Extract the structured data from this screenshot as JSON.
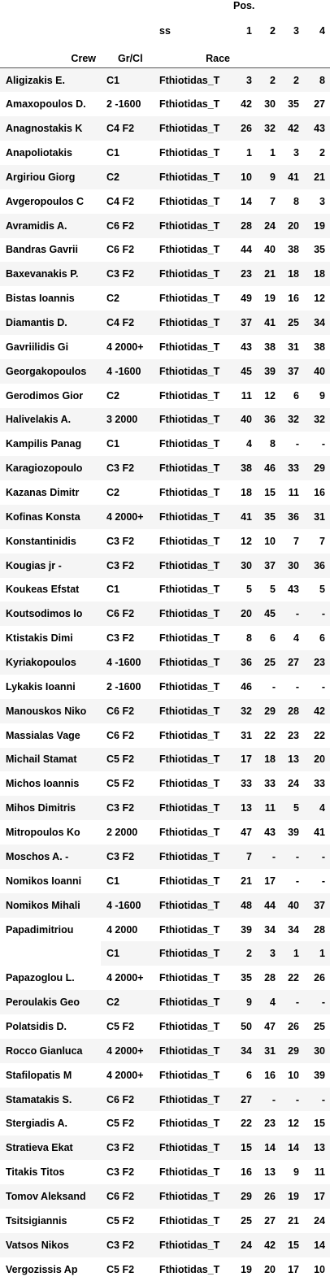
{
  "header": {
    "pos_label": "Pos.",
    "ss_label": "ss",
    "crew_label": "Crew",
    "grcl_label": "Gr/Cl",
    "race_label": "Race",
    "pos_cols": [
      "1",
      "2",
      "3",
      "4"
    ]
  },
  "rows": [
    {
      "crew": "Aligizakis E.",
      "gr": "C1",
      "race": "Fthiotidas_T",
      "p": [
        "3",
        "2",
        "2",
        "8"
      ]
    },
    {
      "crew": "Amaxopoulos D.",
      "gr": "2 -1600",
      "race": "Fthiotidas_T",
      "p": [
        "42",
        "30",
        "35",
        "27"
      ]
    },
    {
      "crew": "Anagnostakis K",
      "gr": "C4 F2",
      "race": "Fthiotidas_T",
      "p": [
        "26",
        "32",
        "42",
        "43"
      ]
    },
    {
      "crew": "Anapoliotakis",
      "gr": "C1",
      "race": "Fthiotidas_T",
      "p": [
        "1",
        "1",
        "3",
        "2"
      ]
    },
    {
      "crew": "Argiriou Giorg",
      "gr": "C2",
      "race": "Fthiotidas_T",
      "p": [
        "10",
        "9",
        "41",
        "21"
      ]
    },
    {
      "crew": "Avgeropoulos C",
      "gr": "C4 F2",
      "race": "Fthiotidas_T",
      "p": [
        "14",
        "7",
        "8",
        "3"
      ]
    },
    {
      "crew": "Avramidis A.",
      "gr": "C6 F2",
      "race": "Fthiotidas_T",
      "p": [
        "28",
        "24",
        "20",
        "19"
      ]
    },
    {
      "crew": "Bandras Gavrii",
      "gr": "C6 F2",
      "race": "Fthiotidas_T",
      "p": [
        "44",
        "40",
        "38",
        "35"
      ]
    },
    {
      "crew": "Baxevanakis P.",
      "gr": "C3 F2",
      "race": "Fthiotidas_T",
      "p": [
        "23",
        "21",
        "18",
        "18"
      ]
    },
    {
      "crew": "Bistas Ioannis",
      "gr": "C2",
      "race": "Fthiotidas_T",
      "p": [
        "49",
        "19",
        "16",
        "12"
      ]
    },
    {
      "crew": "Diamantis D.",
      "gr": "C4 F2",
      "race": "Fthiotidas_T",
      "p": [
        "37",
        "41",
        "25",
        "34"
      ]
    },
    {
      "crew": "Gavriilidis Gi",
      "gr": "4 2000+",
      "race": "Fthiotidas_T",
      "p": [
        "43",
        "38",
        "31",
        "38"
      ]
    },
    {
      "crew": "Georgakopoulos",
      "gr": "4 -1600",
      "race": "Fthiotidas_T",
      "p": [
        "45",
        "39",
        "37",
        "40"
      ]
    },
    {
      "crew": "Gerodimos Gior",
      "gr": "C2",
      "race": "Fthiotidas_T",
      "p": [
        "11",
        "12",
        "6",
        "9"
      ]
    },
    {
      "crew": "Halivelakis A.",
      "gr": "3 2000",
      "race": "Fthiotidas_T",
      "p": [
        "40",
        "36",
        "32",
        "32"
      ]
    },
    {
      "crew": "Kampilis Panag",
      "gr": "C1",
      "race": "Fthiotidas_T",
      "p": [
        "4",
        "8",
        "-",
        "-"
      ]
    },
    {
      "crew": "Karagiozopoulo",
      "gr": "C3 F2",
      "race": "Fthiotidas_T",
      "p": [
        "38",
        "46",
        "33",
        "29"
      ]
    },
    {
      "crew": "Kazanas Dimitr",
      "gr": "C2",
      "race": "Fthiotidas_T",
      "p": [
        "18",
        "15",
        "11",
        "16"
      ]
    },
    {
      "crew": "Kofinas Konsta",
      "gr": "4 2000+",
      "race": "Fthiotidas_T",
      "p": [
        "41",
        "35",
        "36",
        "31"
      ]
    },
    {
      "crew": "Konstantinidis",
      "gr": "C3 F2",
      "race": "Fthiotidas_T",
      "p": [
        "12",
        "10",
        "7",
        "7"
      ]
    },
    {
      "crew": "Kougias jr -",
      "gr": "C3 F2",
      "race": "Fthiotidas_T",
      "p": [
        "30",
        "37",
        "30",
        "36"
      ]
    },
    {
      "crew": "Koukeas Efstat",
      "gr": "C1",
      "race": "Fthiotidas_T",
      "p": [
        "5",
        "5",
        "43",
        "5"
      ]
    },
    {
      "crew": "Koutsodimos Io",
      "gr": "C6 F2",
      "race": "Fthiotidas_T",
      "p": [
        "20",
        "45",
        "-",
        "-"
      ]
    },
    {
      "crew": "Ktistakis Dimi",
      "gr": "C3 F2",
      "race": "Fthiotidas_T",
      "p": [
        "8",
        "6",
        "4",
        "6"
      ]
    },
    {
      "crew": "Kyriakopoulos",
      "gr": "4 -1600",
      "race": "Fthiotidas_T",
      "p": [
        "36",
        "25",
        "27",
        "23"
      ]
    },
    {
      "crew": "Lykakis Ioanni",
      "gr": "2 -1600",
      "race": "Fthiotidas_T",
      "p": [
        "46",
        "-",
        "-",
        "-"
      ]
    },
    {
      "crew": "Manouskos Niko",
      "gr": "C6 F2",
      "race": "Fthiotidas_T",
      "p": [
        "32",
        "29",
        "28",
        "42"
      ]
    },
    {
      "crew": "Massialas Vage",
      "gr": "C6 F2",
      "race": "Fthiotidas_T",
      "p": [
        "31",
        "22",
        "23",
        "22"
      ]
    },
    {
      "crew": "Michail Stamat",
      "gr": "C5 F2",
      "race": "Fthiotidas_T",
      "p": [
        "17",
        "18",
        "13",
        "20"
      ]
    },
    {
      "crew": "Michos Ioannis",
      "gr": "C5 F2",
      "race": "Fthiotidas_T",
      "p": [
        "33",
        "33",
        "24",
        "33"
      ]
    },
    {
      "crew": "Mihos Dimitris",
      "gr": "C3 F2",
      "race": "Fthiotidas_T",
      "p": [
        "13",
        "11",
        "5",
        "4"
      ]
    },
    {
      "crew": "Mitropoulos Ko",
      "gr": "2 2000",
      "race": "Fthiotidas_T",
      "p": [
        "47",
        "43",
        "39",
        "41"
      ]
    },
    {
      "crew": "Moschos A. -",
      "gr": "C3 F2",
      "race": "Fthiotidas_T",
      "p": [
        "7",
        "-",
        "-",
        "-"
      ]
    },
    {
      "crew": "Nomikos Ioanni",
      "gr": "C1",
      "race": "Fthiotidas_T",
      "p": [
        "21",
        "17",
        "-",
        "-"
      ]
    },
    {
      "crew": "Nomikos Mihali",
      "gr": "4 -1600",
      "race": "Fthiotidas_T",
      "p": [
        "48",
        "44",
        "40",
        "37"
      ]
    },
    {
      "crew": "Papadimitriou",
      "gr": "4 2000",
      "race": "Fthiotidas_T",
      "p": [
        "39",
        "34",
        "34",
        "28"
      ]
    },
    {
      "crew": "",
      "gr": "C1",
      "race": "Fthiotidas_T",
      "p": [
        "2",
        "3",
        "1",
        "1"
      ]
    },
    {
      "crew": "Papazoglou L.",
      "gr": "4 2000+",
      "race": "Fthiotidas_T",
      "p": [
        "35",
        "28",
        "22",
        "26"
      ]
    },
    {
      "crew": "Peroulakis Geo",
      "gr": "C2",
      "race": "Fthiotidas_T",
      "p": [
        "9",
        "4",
        "-",
        "-"
      ]
    },
    {
      "crew": "Polatsidis D.",
      "gr": "C5 F2",
      "race": "Fthiotidas_T",
      "p": [
        "50",
        "47",
        "26",
        "25"
      ]
    },
    {
      "crew": "Rocco Gianluca",
      "gr": "4 2000+",
      "race": "Fthiotidas_T",
      "p": [
        "34",
        "31",
        "29",
        "30"
      ]
    },
    {
      "crew": "Stafilopatis M",
      "gr": "4 2000+",
      "race": "Fthiotidas_T",
      "p": [
        "6",
        "16",
        "10",
        "39"
      ]
    },
    {
      "crew": "Stamatakis S.",
      "gr": "C6 F2",
      "race": "Fthiotidas_T",
      "p": [
        "27",
        "-",
        "-",
        "-"
      ]
    },
    {
      "crew": "Stergiadis A.",
      "gr": "C5 F2",
      "race": "Fthiotidas_T",
      "p": [
        "22",
        "23",
        "12",
        "15"
      ]
    },
    {
      "crew": "Stratieva Ekat",
      "gr": "C3 F2",
      "race": "Fthiotidas_T",
      "p": [
        "15",
        "14",
        "14",
        "13"
      ]
    },
    {
      "crew": "Titakis Titos",
      "gr": "C3 F2",
      "race": "Fthiotidas_T",
      "p": [
        "16",
        "13",
        "9",
        "11"
      ]
    },
    {
      "crew": "Tomov Aleksand",
      "gr": "C6 F2",
      "race": "Fthiotidas_T",
      "p": [
        "29",
        "26",
        "19",
        "17"
      ]
    },
    {
      "crew": "Tsitsigiannis",
      "gr": "C5 F2",
      "race": "Fthiotidas_T",
      "p": [
        "25",
        "27",
        "21",
        "24"
      ]
    },
    {
      "crew": "Vatsos Nikos",
      "gr": "C3 F2",
      "race": "Fthiotidas_T",
      "p": [
        "24",
        "42",
        "15",
        "14"
      ]
    },
    {
      "crew": "Vergozissis Ap",
      "gr": "C5 F2",
      "race": "Fthiotidas_T",
      "p": [
        "19",
        "20",
        "17",
        "10"
      ]
    }
  ]
}
